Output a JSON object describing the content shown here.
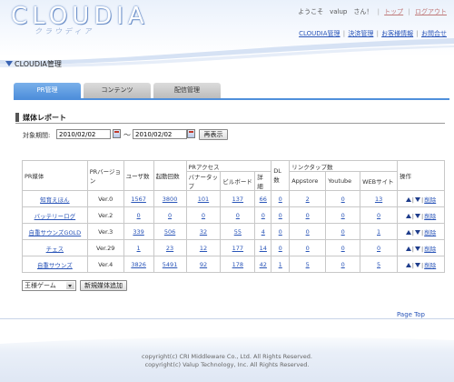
{
  "header": {
    "logo": "CLOUDIA",
    "logo_kana": "クラウディア",
    "welcome": "ようこそ　valup　さん！",
    "top_link": "トップ",
    "logout": "ログアウト",
    "links": [
      "CLOUDIA管理",
      "決済管理",
      "お客様情報",
      "お問合せ"
    ],
    "separator": "|"
  },
  "section": {
    "title": "CLOUDIA管理"
  },
  "tabs": [
    "PR管理",
    "コンテンツ",
    "配信管理"
  ],
  "report": {
    "title": "媒体レポート",
    "period_label": "対象期間:",
    "date_from": "2010/02/02",
    "tilde": "～",
    "date_to": "2010/02/02",
    "show_button": "再表示"
  },
  "table": {
    "headers": {
      "media": "PR媒体",
      "version": "PRバージョン",
      "users": "ユーザ数",
      "launches": "起動回数",
      "pr_access": "PRアクセス",
      "banner_tap": "バナータップ",
      "billboard": "ビルボード",
      "detail": "詳細",
      "dl": "DL数",
      "link_tap": "リンクタップ数",
      "appstore": "Appstore",
      "youtube": "Youtube",
      "website": "WEBサイト",
      "ops": "操作"
    },
    "rows": [
      {
        "name": "知育えほん",
        "version": "Ver.0",
        "users": "1567",
        "launches": "3800",
        "banner": "101",
        "billboard": "137",
        "detail": "66",
        "dl": "0",
        "appstore": "2",
        "youtube": "0",
        "web": "13"
      },
      {
        "name": "バッテリーログ",
        "version": "Ver.2",
        "users": "0",
        "launches": "0",
        "banner": "0",
        "billboard": "0",
        "detail": "0",
        "dl": "0",
        "appstore": "0",
        "youtube": "0",
        "web": "0"
      },
      {
        "name": "自重サウンズGOLD",
        "version": "Ver.3",
        "users": "339",
        "launches": "506",
        "banner": "32",
        "billboard": "55",
        "detail": "4",
        "dl": "0",
        "appstore": "0",
        "youtube": "0",
        "web": "1"
      },
      {
        "name": "チェス",
        "version": "Ver.29",
        "users": "1",
        "launches": "23",
        "banner": "12",
        "billboard": "177",
        "detail": "14",
        "dl": "0",
        "appstore": "0",
        "youtube": "0",
        "web": "0"
      },
      {
        "name": "自重サウンズ",
        "version": "Ver.4",
        "users": "3826",
        "launches": "5491",
        "banner": "92",
        "billboard": "178",
        "detail": "42",
        "dl": "1",
        "appstore": "5",
        "youtube": "0",
        "web": "5"
      }
    ],
    "delete_label": "削除",
    "op_sep": "|"
  },
  "genre_select": "王様ゲーム",
  "add_media_button": "新規媒体追加",
  "page_top": "Page Top",
  "footer": {
    "line1": "copyright(c) CRI Middleware Co., Ltd. All Rights Reserved.",
    "line2": "copyright(c) Valup Technology, Inc. All Rights Reserved."
  },
  "colors": {
    "accent": "#4f8fdb",
    "link": "#2a55b8",
    "arrow": "#1f3d8c"
  }
}
